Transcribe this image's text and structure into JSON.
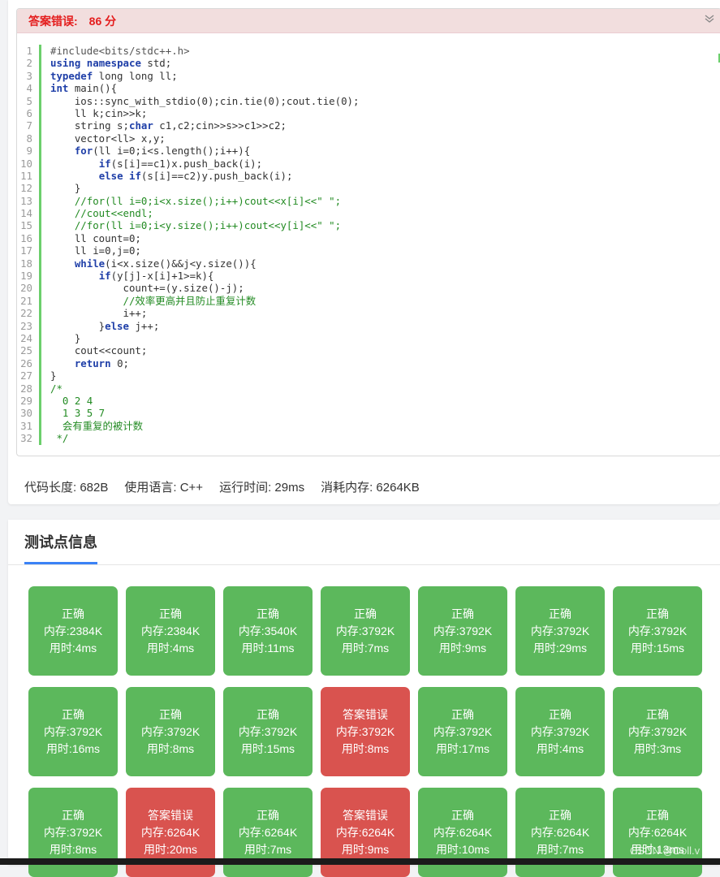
{
  "result": {
    "status": "答案错误:",
    "score": "86 分"
  },
  "code_lines": [
    "#include<bits/stdc++.h>",
    "using namespace std;",
    "typedef long long ll;",
    "int main(){",
    "    ios::sync_with_stdio(0);cin.tie(0);cout.tie(0);",
    "    ll k;cin>>k;",
    "    string s;char c1,c2;cin>>s>>c1>>c2;",
    "    vector<ll> x,y;",
    "    for(ll i=0;i<s.length();i++){",
    "        if(s[i]==c1)x.push_back(i);",
    "        else if(s[i]==c2)y.push_back(i);",
    "    }",
    "    //for(ll i=0;i<x.size();i++)cout<<x[i]<<\" \";",
    "    //cout<<endl;",
    "    //for(ll i=0;i<y.size();i++)cout<<y[i]<<\" \";",
    "    ll count=0;",
    "    ll i=0,j=0;",
    "    while(i<x.size()&&j<y.size()){",
    "        if(y[j]-x[i]+1>=k){",
    "            count+=(y.size()-j);",
    "            //效率更高并且防止重复计数",
    "            i++;",
    "        }else j++;",
    "    }",
    "    cout<<count;",
    "    return 0;",
    "}",
    "/*",
    "  0 2 4",
    "  1 3 5 7",
    "  会有重复的被计数",
    " */"
  ],
  "summary": {
    "code_length": "代码长度: 682B",
    "language": "使用语言: C++",
    "run_time": "运行时间: 29ms",
    "memory": "消耗内存: 6264KB"
  },
  "tests_title": "测试点信息",
  "tests": [
    {
      "status": "正确",
      "mem": "内存:2384K",
      "time": "用时:4ms",
      "ok": true
    },
    {
      "status": "正确",
      "mem": "内存:2384K",
      "time": "用时:4ms",
      "ok": true
    },
    {
      "status": "正确",
      "mem": "内存:3540K",
      "time": "用时:11ms",
      "ok": true
    },
    {
      "status": "正确",
      "mem": "内存:3792K",
      "time": "用时:7ms",
      "ok": true
    },
    {
      "status": "正确",
      "mem": "内存:3792K",
      "time": "用时:9ms",
      "ok": true
    },
    {
      "status": "正确",
      "mem": "内存:3792K",
      "time": "用时:29ms",
      "ok": true
    },
    {
      "status": "正确",
      "mem": "内存:3792K",
      "time": "用时:15ms",
      "ok": true
    },
    {
      "status": "正确",
      "mem": "内存:3792K",
      "time": "用时:16ms",
      "ok": true
    },
    {
      "status": "正确",
      "mem": "内存:3792K",
      "time": "用时:8ms",
      "ok": true
    },
    {
      "status": "正确",
      "mem": "内存:3792K",
      "time": "用时:15ms",
      "ok": true
    },
    {
      "status": "答案错误",
      "mem": "内存:3792K",
      "time": "用时:8ms",
      "ok": false
    },
    {
      "status": "正确",
      "mem": "内存:3792K",
      "time": "用时:17ms",
      "ok": true
    },
    {
      "status": "正确",
      "mem": "内存:3792K",
      "time": "用时:4ms",
      "ok": true
    },
    {
      "status": "正确",
      "mem": "内存:3792K",
      "time": "用时:3ms",
      "ok": true
    },
    {
      "status": "正确",
      "mem": "内存:3792K",
      "time": "用时:8ms",
      "ok": true
    },
    {
      "status": "答案错误",
      "mem": "内存:6264K",
      "time": "用时:20ms",
      "ok": false
    },
    {
      "status": "正确",
      "mem": "内存:6264K",
      "time": "用时:7ms",
      "ok": true
    },
    {
      "status": "答案错误",
      "mem": "内存:6264K",
      "time": "用时:9ms",
      "ok": false
    },
    {
      "status": "正确",
      "mem": "内存:6264K",
      "time": "用时:10ms",
      "ok": true
    },
    {
      "status": "正确",
      "mem": "内存:6264K",
      "time": "用时:7ms",
      "ok": true
    },
    {
      "status": "正确",
      "mem": "内存:6264K",
      "time": "用时:13ms",
      "ok": true
    }
  ],
  "watermark": "CSDN @Doll.v",
  "colors": {
    "accepted": "#5cb85c",
    "wrong_answer": "#d9534f",
    "tab_underline": "#3b82f6",
    "header_bg": "#f2dede"
  }
}
